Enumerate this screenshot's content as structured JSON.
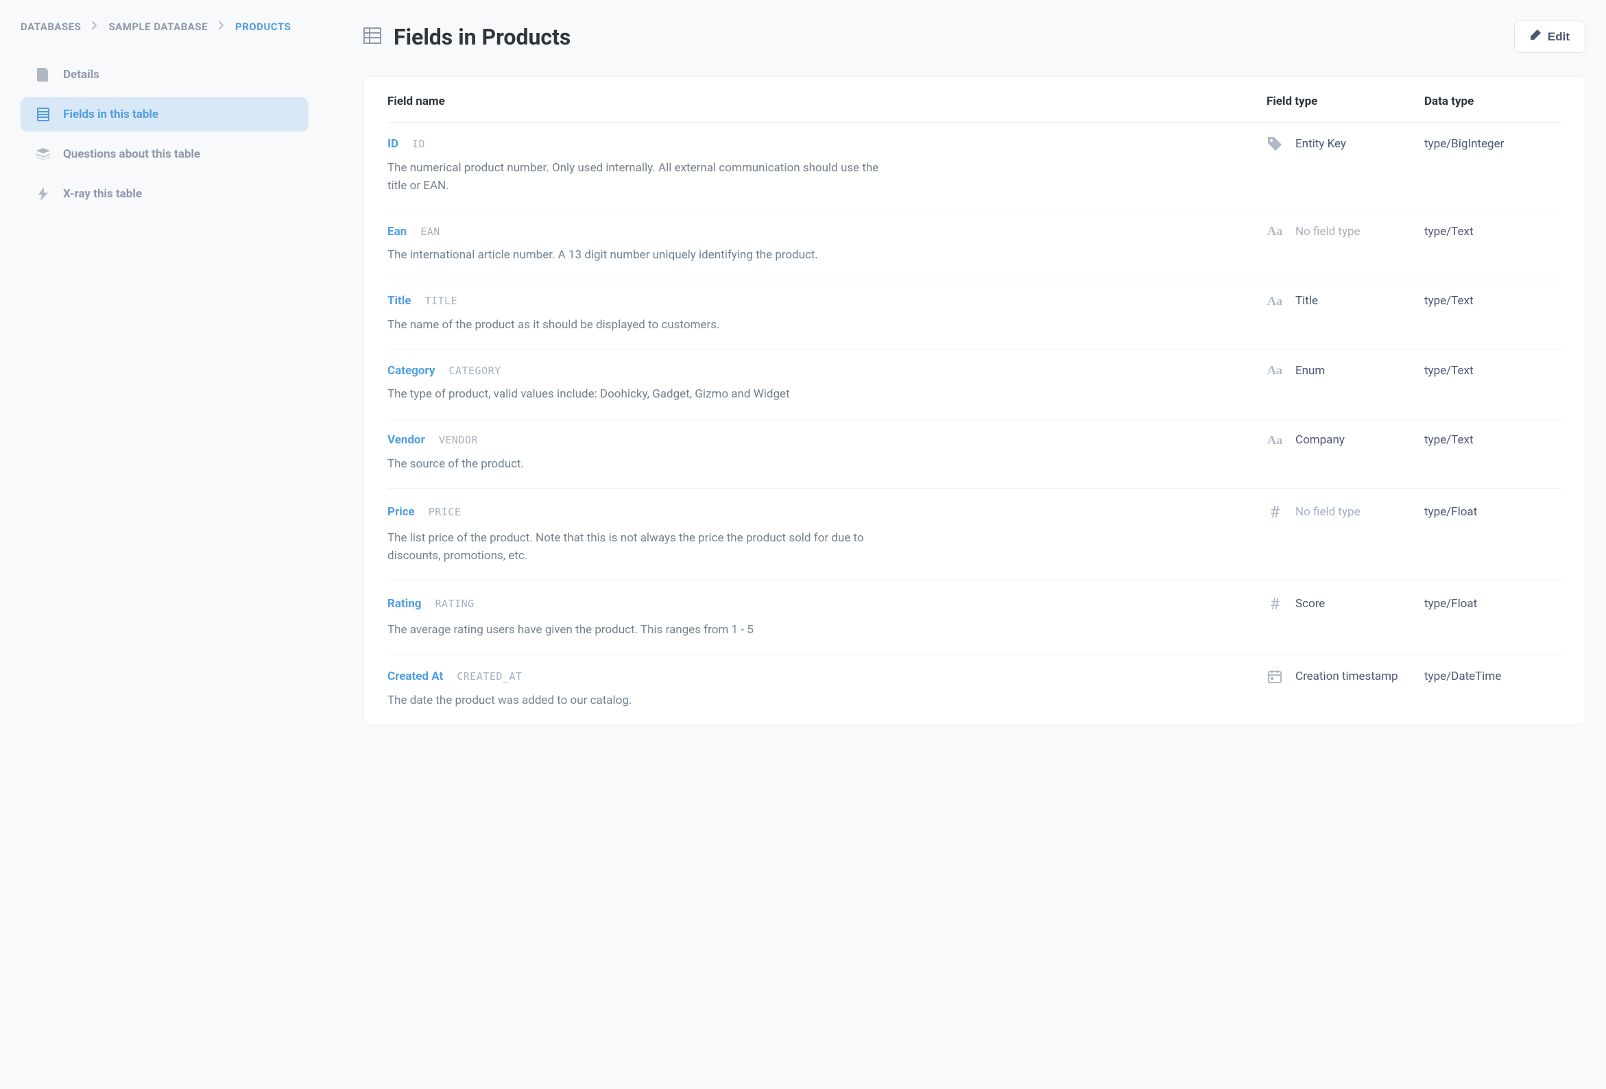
{
  "breadcrumb": {
    "items": [
      {
        "label": "DATABASES"
      },
      {
        "label": "SAMPLE DATABASE"
      },
      {
        "label": "PRODUCTS"
      }
    ]
  },
  "sidebar": {
    "items": [
      {
        "label": "Details"
      },
      {
        "label": "Fields in this table"
      },
      {
        "label": "Questions about this table"
      },
      {
        "label": "X-ray this table"
      }
    ]
  },
  "header": {
    "title": "Fields in Products",
    "edit_label": "Edit"
  },
  "columns": {
    "name": "Field name",
    "ftype": "Field type",
    "dtype": "Data type"
  },
  "fields": [
    {
      "name": "ID",
      "db": "ID",
      "type_icon": "tag",
      "ftype": "Entity Key",
      "ftype_muted": false,
      "dtype": "type/BigInteger",
      "desc": "The numerical product number. Only used internally. All external communication should use the title or EAN."
    },
    {
      "name": "Ean",
      "db": "EAN",
      "type_icon": "aa",
      "ftype": "No field type",
      "ftype_muted": true,
      "dtype": "type/Text",
      "desc": "The international article number. A 13 digit number uniquely identifying the product."
    },
    {
      "name": "Title",
      "db": "TITLE",
      "type_icon": "aa",
      "ftype": "Title",
      "ftype_muted": false,
      "dtype": "type/Text",
      "desc": "The name of the product as it should be displayed to customers."
    },
    {
      "name": "Category",
      "db": "CATEGORY",
      "type_icon": "aa",
      "ftype": "Enum",
      "ftype_muted": false,
      "dtype": "type/Text",
      "desc": "The type of product, valid values include: Doohicky, Gadget, Gizmo and Widget"
    },
    {
      "name": "Vendor",
      "db": "VENDOR",
      "type_icon": "aa",
      "ftype": "Company",
      "ftype_muted": false,
      "dtype": "type/Text",
      "desc": "The source of the product."
    },
    {
      "name": "Price",
      "db": "PRICE",
      "type_icon": "hash",
      "ftype": "No field type",
      "ftype_muted": true,
      "dtype": "type/Float",
      "desc": "The list price of the product. Note that this is not always the price the product sold for due to discounts, promotions, etc."
    },
    {
      "name": "Rating",
      "db": "RATING",
      "type_icon": "hash",
      "ftype": "Score",
      "ftype_muted": false,
      "dtype": "type/Float",
      "desc": "The average rating users have given the product. This ranges from 1 - 5"
    },
    {
      "name": "Created At",
      "db": "CREATED_AT",
      "type_icon": "calendar",
      "ftype": "Creation timestamp",
      "ftype_muted": false,
      "dtype": "type/DateTime",
      "desc": "The date the product was added to our catalog."
    }
  ]
}
